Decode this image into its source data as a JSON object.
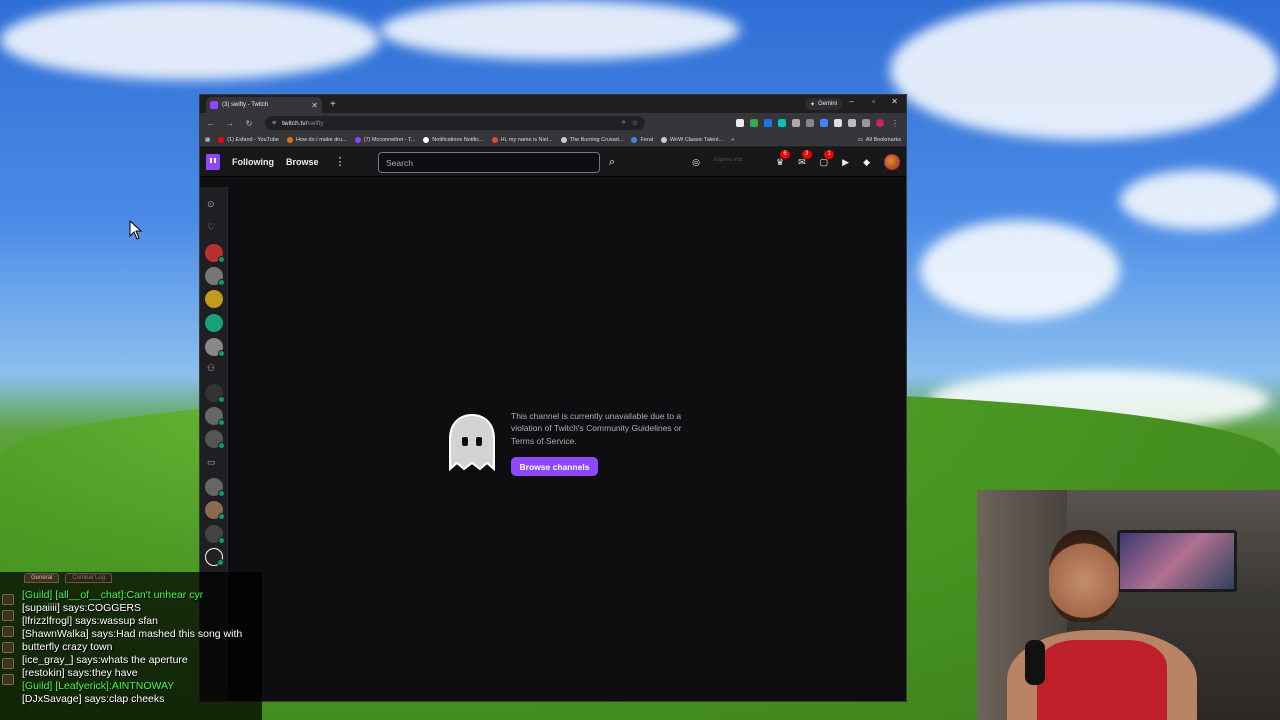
{
  "browser": {
    "tab_title": "(3) swifty - Twitch",
    "gemini_label": "Gemini",
    "url_host": "twitch.tv/",
    "url_path": "swifty",
    "bookmarks": [
      {
        "label": "(1) Esfand - YouTube",
        "color": "#ff0000"
      },
      {
        "label": "How do I make dru...",
        "color": "#e8710a"
      },
      {
        "label": "(7) Mcconnellret - T...",
        "color": "#9146ff"
      },
      {
        "label": "Notifications Notific...",
        "color": "#ffffff"
      },
      {
        "label": "Hi, my name is Niel...",
        "color": "#e8453c"
      },
      {
        "label": "The Burning Crusad...",
        "color": "#cccccc"
      },
      {
        "label": "Feral",
        "color": "#4285f4"
      },
      {
        "label": "WoW Classic Talent...",
        "color": "#cccccc"
      }
    ],
    "all_bookmarks": "All Bookmarks"
  },
  "twitch": {
    "following": "Following",
    "browse": "Browse",
    "search_placeholder": "Search",
    "prime_placeholder": "Express Vod",
    "badges": {
      "notifications": "6",
      "whispers": "3",
      "inbox": "1"
    },
    "message": "This channel is currently unavailable due to a violation of Twitch's Community Guidelines or Terms of Service.",
    "browse_button": "Browse channels"
  },
  "game_chat": {
    "tabs": [
      "General",
      "Combat Log"
    ],
    "lines": [
      {
        "text": "[Guild] [all__of__chat]:Can't unhear cyr",
        "type": "guild"
      },
      {
        "text": "[supaiiii] says:COGGERS",
        "type": "say"
      },
      {
        "text": "[lfrizzlfrogl] says:wassup sfan",
        "type": "say"
      },
      {
        "text": "[ShawnWalka] says:Had mashed this song with butterfly crazy town",
        "type": "say"
      },
      {
        "text": "[ice_gray_] says:whats the aperture",
        "type": "say"
      },
      {
        "text": "[restokin] says:they have",
        "type": "say"
      },
      {
        "text": "[Guild] [Leafyerick]:AINTNOWAY",
        "type": "guild"
      },
      {
        "text": "[DJxSavage] says:clap cheeks",
        "type": "say"
      }
    ]
  },
  "colors": {
    "twitch_purple": "#9147ff",
    "badge_red": "#eb0400",
    "guild_green": "#40ff40"
  }
}
